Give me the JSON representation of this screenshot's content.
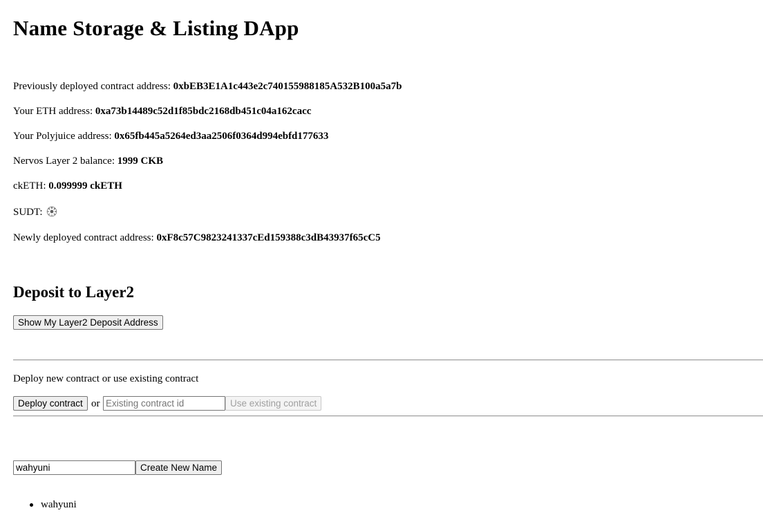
{
  "app": {
    "title": "Name Storage & Listing DApp"
  },
  "info": {
    "prev_contract_label": "Previously deployed contract address: ",
    "prev_contract_value": "0xbEB3E1A1c443e2c740155988185A532B100a5a7b",
    "eth_label": "Your ETH address: ",
    "eth_value": "0xa73b14489c52d1f85bdc2168db451c04a162cacc",
    "polyjuice_label": "Your Polyjuice address: ",
    "polyjuice_value": "0x65fb445a5264ed3aa2506f0364d994ebfd177633",
    "balance_label": "Nervos Layer 2 balance: ",
    "balance_value": "1999 CKB",
    "cketh_label": "ckETH: ",
    "cketh_value": "0.099999 ckETH",
    "sudt_label": "SUDT: ",
    "sudt_icon": "loading-spinner-icon",
    "new_contract_label": "Newly deployed contract address: ",
    "new_contract_value": "0xF8c57C9823241337cEd159388c3dB43937f65cC5"
  },
  "deposit": {
    "heading": "Deposit to Layer2",
    "show_address_button": "Show My Layer2 Deposit Address"
  },
  "contract": {
    "prompt": "Deploy new contract or use existing contract",
    "deploy_button": "Deploy contract",
    "or_text": "or",
    "existing_id_value": "",
    "existing_id_placeholder": "Existing contract id",
    "use_existing_button": "Use existing contract"
  },
  "names": {
    "input_value": "wahyuni",
    "create_button": "Create New Name",
    "list": [
      "wahyuni"
    ]
  }
}
